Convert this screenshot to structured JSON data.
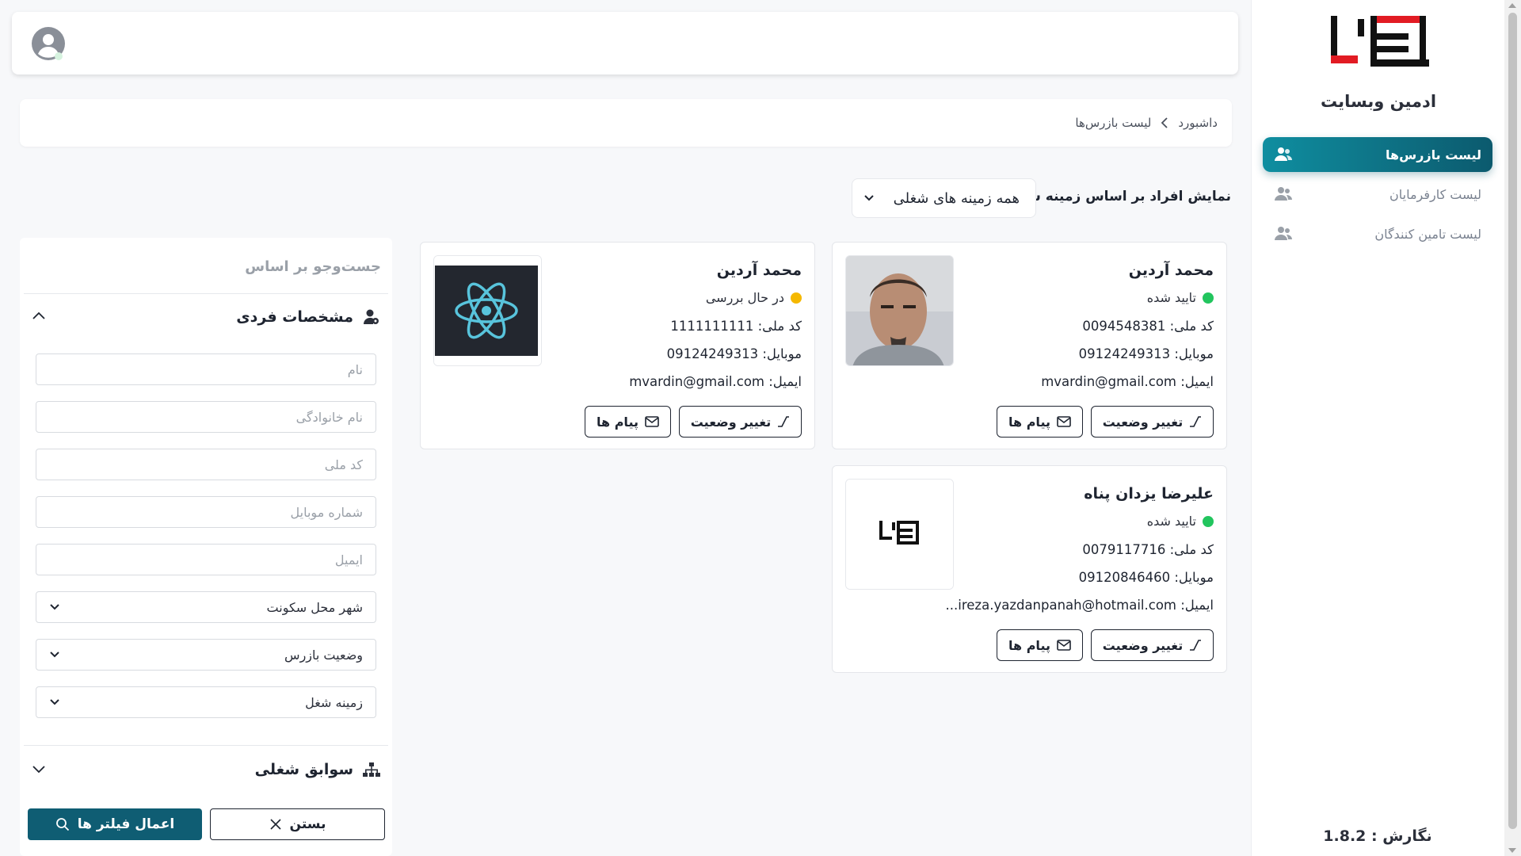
{
  "sidebar": {
    "title": "ادمین وبسایت",
    "items": [
      {
        "label": "لیست بازرس‌ها",
        "icon": "users-icon",
        "active": true
      },
      {
        "label": "لیست کارفرمایان",
        "icon": "users-icon",
        "active": false
      },
      {
        "label": "لیست تامین کنندگان",
        "icon": "users-icon",
        "active": false
      }
    ],
    "version": "نگارش : 1.8.2"
  },
  "breadcrumb": {
    "home": "داشبورد",
    "current": "لیست بازرس‌ها"
  },
  "field_filter": {
    "label": "نمایش افراد بر اساس زمینه شغلی:",
    "selected": "همه زمینه های شغلی"
  },
  "cards": [
    {
      "name": "محمد آردین",
      "status": "تایید شده",
      "status_color": "#22c55e",
      "national_code": "کد ملی: 0094548381",
      "mobile": "موبایل: 09124249313",
      "email": "ایمیل: mvardin@gmail.com",
      "photo": "person-photo",
      "status_button": "تغییر وضعیت",
      "message_button": "پیام ها"
    },
    {
      "name": "محمد آردین",
      "status": "در حال بررسی",
      "status_color": "#f5b800",
      "national_code": "کد ملی: 1111111111",
      "mobile": "موبایل: 09124249313",
      "email": "ایمیل: mvardin@gmail.com",
      "photo": "react-logo",
      "status_button": "تغییر وضعیت",
      "message_button": "پیام ها"
    },
    {
      "name": "علیرضا یزدان پناه",
      "status": "تایید شده",
      "status_color": "#22c55e",
      "national_code": "کد ملی: 0079117716",
      "mobile": "موبایل: 09120846460",
      "email": "ایمیل: alireza.yazdanpanah@hotmail.com",
      "email_display": "ایمیل: ireza.yazdanpanah@hotmail.com...",
      "photo": "brand-logo",
      "status_button": "تغییر وضعیت",
      "message_button": "پیام ها"
    }
  ],
  "filters": {
    "title": "جست‌وجو بر اساس",
    "personal_section": "مشخصات فردی",
    "first_name_placeholder": "نام",
    "last_name_placeholder": "نام خانوادگی",
    "national_code_placeholder": "کد ملی",
    "mobile_placeholder": "شماره موبایل",
    "email_placeholder": "ایمیل",
    "city_select": "شهر محل سکونت",
    "inspector_status_select": "وضعیت بازرس",
    "job_field_select": "زمینه شغل",
    "work_history_section": "سوابق شغلی",
    "close_button": "بستن",
    "apply_button": "اعمال فیلتر ها"
  },
  "colors": {
    "accent": "#0f5d73",
    "approved": "#22c55e",
    "pending": "#f5b800"
  }
}
